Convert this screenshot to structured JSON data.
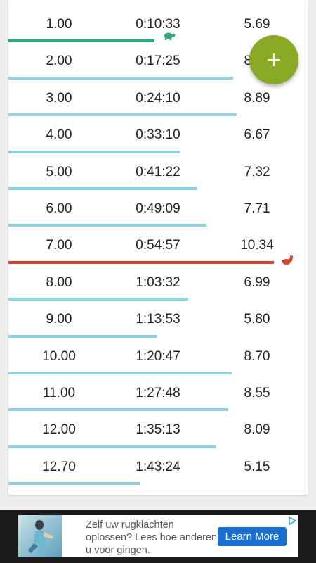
{
  "colors": {
    "normal_bar": "#8fd3e0",
    "slowest_bar": "#2bab76",
    "fastest_bar": "#d7462a",
    "fab": "#8aa823",
    "ad_button": "#1a6fd1"
  },
  "splits": [
    {
      "km": "1.00",
      "time": "0:10:33",
      "speed": "5.69",
      "speed_value": 5.69,
      "kind": "slowest"
    },
    {
      "km": "2.00",
      "time": "0:17:25",
      "speed": "8.74",
      "speed_value": 8.74,
      "kind": "normal"
    },
    {
      "km": "3.00",
      "time": "0:24:10",
      "speed": "8.89",
      "speed_value": 8.89,
      "kind": "normal"
    },
    {
      "km": "4.00",
      "time": "0:33:10",
      "speed": "6.67",
      "speed_value": 6.67,
      "kind": "normal"
    },
    {
      "km": "5.00",
      "time": "0:41:22",
      "speed": "7.32",
      "speed_value": 7.32,
      "kind": "normal"
    },
    {
      "km": "6.00",
      "time": "0:49:09",
      "speed": "7.71",
      "speed_value": 7.71,
      "kind": "normal"
    },
    {
      "km": "7.00",
      "time": "0:54:57",
      "speed": "10.34",
      "speed_value": 10.34,
      "kind": "fastest"
    },
    {
      "km": "8.00",
      "time": "1:03:32",
      "speed": "6.99",
      "speed_value": 6.99,
      "kind": "normal"
    },
    {
      "km": "9.00",
      "time": "1:13:53",
      "speed": "5.80",
      "speed_value": 5.8,
      "kind": "normal"
    },
    {
      "km": "10.00",
      "time": "1:20:47",
      "speed": "8.70",
      "speed_value": 8.7,
      "kind": "normal"
    },
    {
      "km": "11.00",
      "time": "1:27:48",
      "speed": "8.55",
      "speed_value": 8.55,
      "kind": "normal"
    },
    {
      "km": "12.00",
      "time": "1:35:13",
      "speed": "8.09",
      "speed_value": 8.09,
      "kind": "normal"
    },
    {
      "km": "12.70",
      "time": "1:43:24",
      "speed": "5.15",
      "speed_value": 5.15,
      "kind": "normal"
    }
  ],
  "fab": {
    "icon": "plus-icon"
  },
  "ad": {
    "text": "Zelf uw rugklachten oplossen? Lees hoe anderen u voor gingen.",
    "button_label": "Learn More",
    "choices_icon": "ad-choices-icon"
  }
}
